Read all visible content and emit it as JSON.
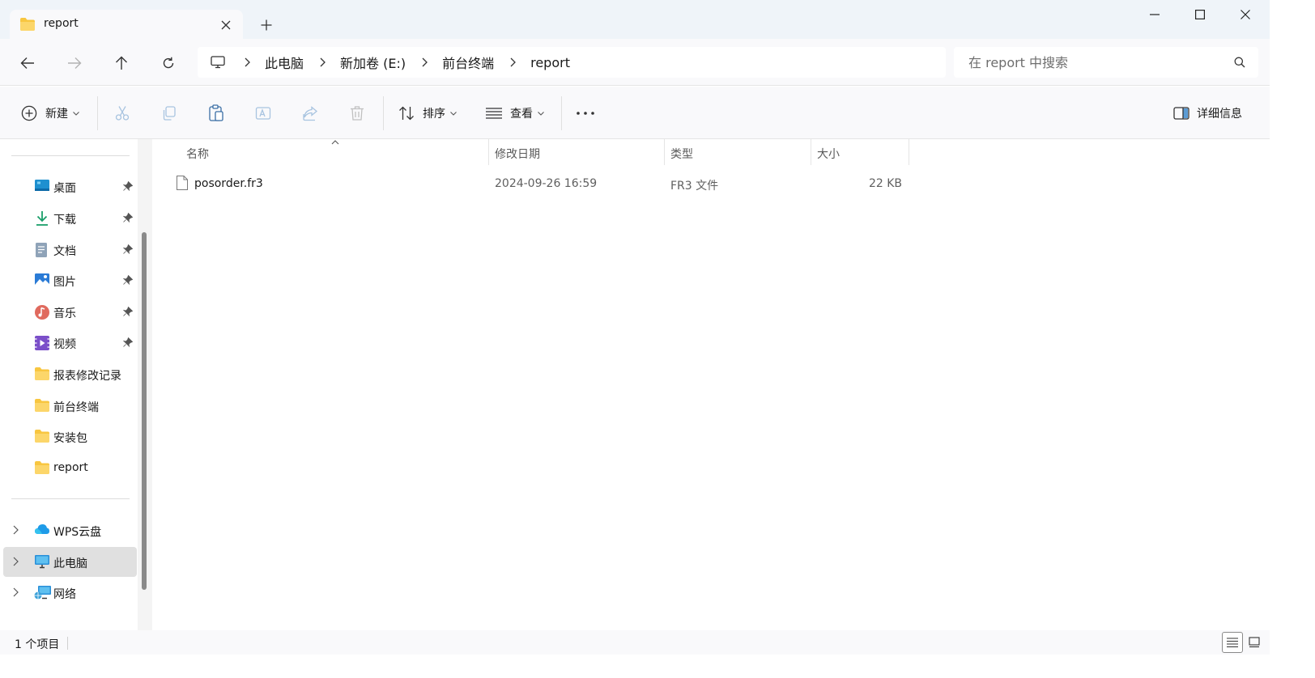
{
  "tab": {
    "title": "report"
  },
  "navigation": {
    "breadcrumbs": [
      "此电脑",
      "新加卷 (E:)",
      "前台终端",
      "report"
    ]
  },
  "search": {
    "placeholder": "在 report 中搜索",
    "value": ""
  },
  "toolbar": {
    "new_label": "新建",
    "sort_label": "排序",
    "view_label": "查看",
    "details_label": "详细信息"
  },
  "sidebar": {
    "quick_access": [
      {
        "label": "桌面",
        "icon": "desktop-icon",
        "pinned": true
      },
      {
        "label": "下载",
        "icon": "download-icon",
        "pinned": true
      },
      {
        "label": "文档",
        "icon": "documents-icon",
        "pinned": true
      },
      {
        "label": "图片",
        "icon": "pictures-icon",
        "pinned": true
      },
      {
        "label": "音乐",
        "icon": "music-icon",
        "pinned": true
      },
      {
        "label": "视频",
        "icon": "videos-icon",
        "pinned": true
      },
      {
        "label": "报表修改记录",
        "icon": "folder-icon",
        "pinned": false
      },
      {
        "label": "前台终端",
        "icon": "folder-icon",
        "pinned": false
      },
      {
        "label": "安装包",
        "icon": "folder-icon",
        "pinned": false
      },
      {
        "label": "report",
        "icon": "folder-icon",
        "pinned": false
      }
    ],
    "locations": [
      {
        "label": "WPS云盘",
        "icon": "wps-cloud-icon",
        "selected": false
      },
      {
        "label": "此电脑",
        "icon": "this-pc-icon",
        "selected": true
      },
      {
        "label": "网络",
        "icon": "network-icon",
        "selected": false
      }
    ]
  },
  "file_list": {
    "columns": [
      "名称",
      "修改日期",
      "类型",
      "大小"
    ],
    "rows": [
      {
        "name": "posorder.fr3",
        "modified": "2024-09-26 16:59",
        "type": "FR3 文件",
        "size": "22 KB"
      }
    ]
  },
  "statusbar": {
    "item_count": "1 个项目"
  },
  "colors": {
    "title_bg": "#eff4f9",
    "chrome_bg": "#f9f9fb",
    "selected_bg": "#e0e0e0",
    "folder_yellow": "#f8c640"
  }
}
